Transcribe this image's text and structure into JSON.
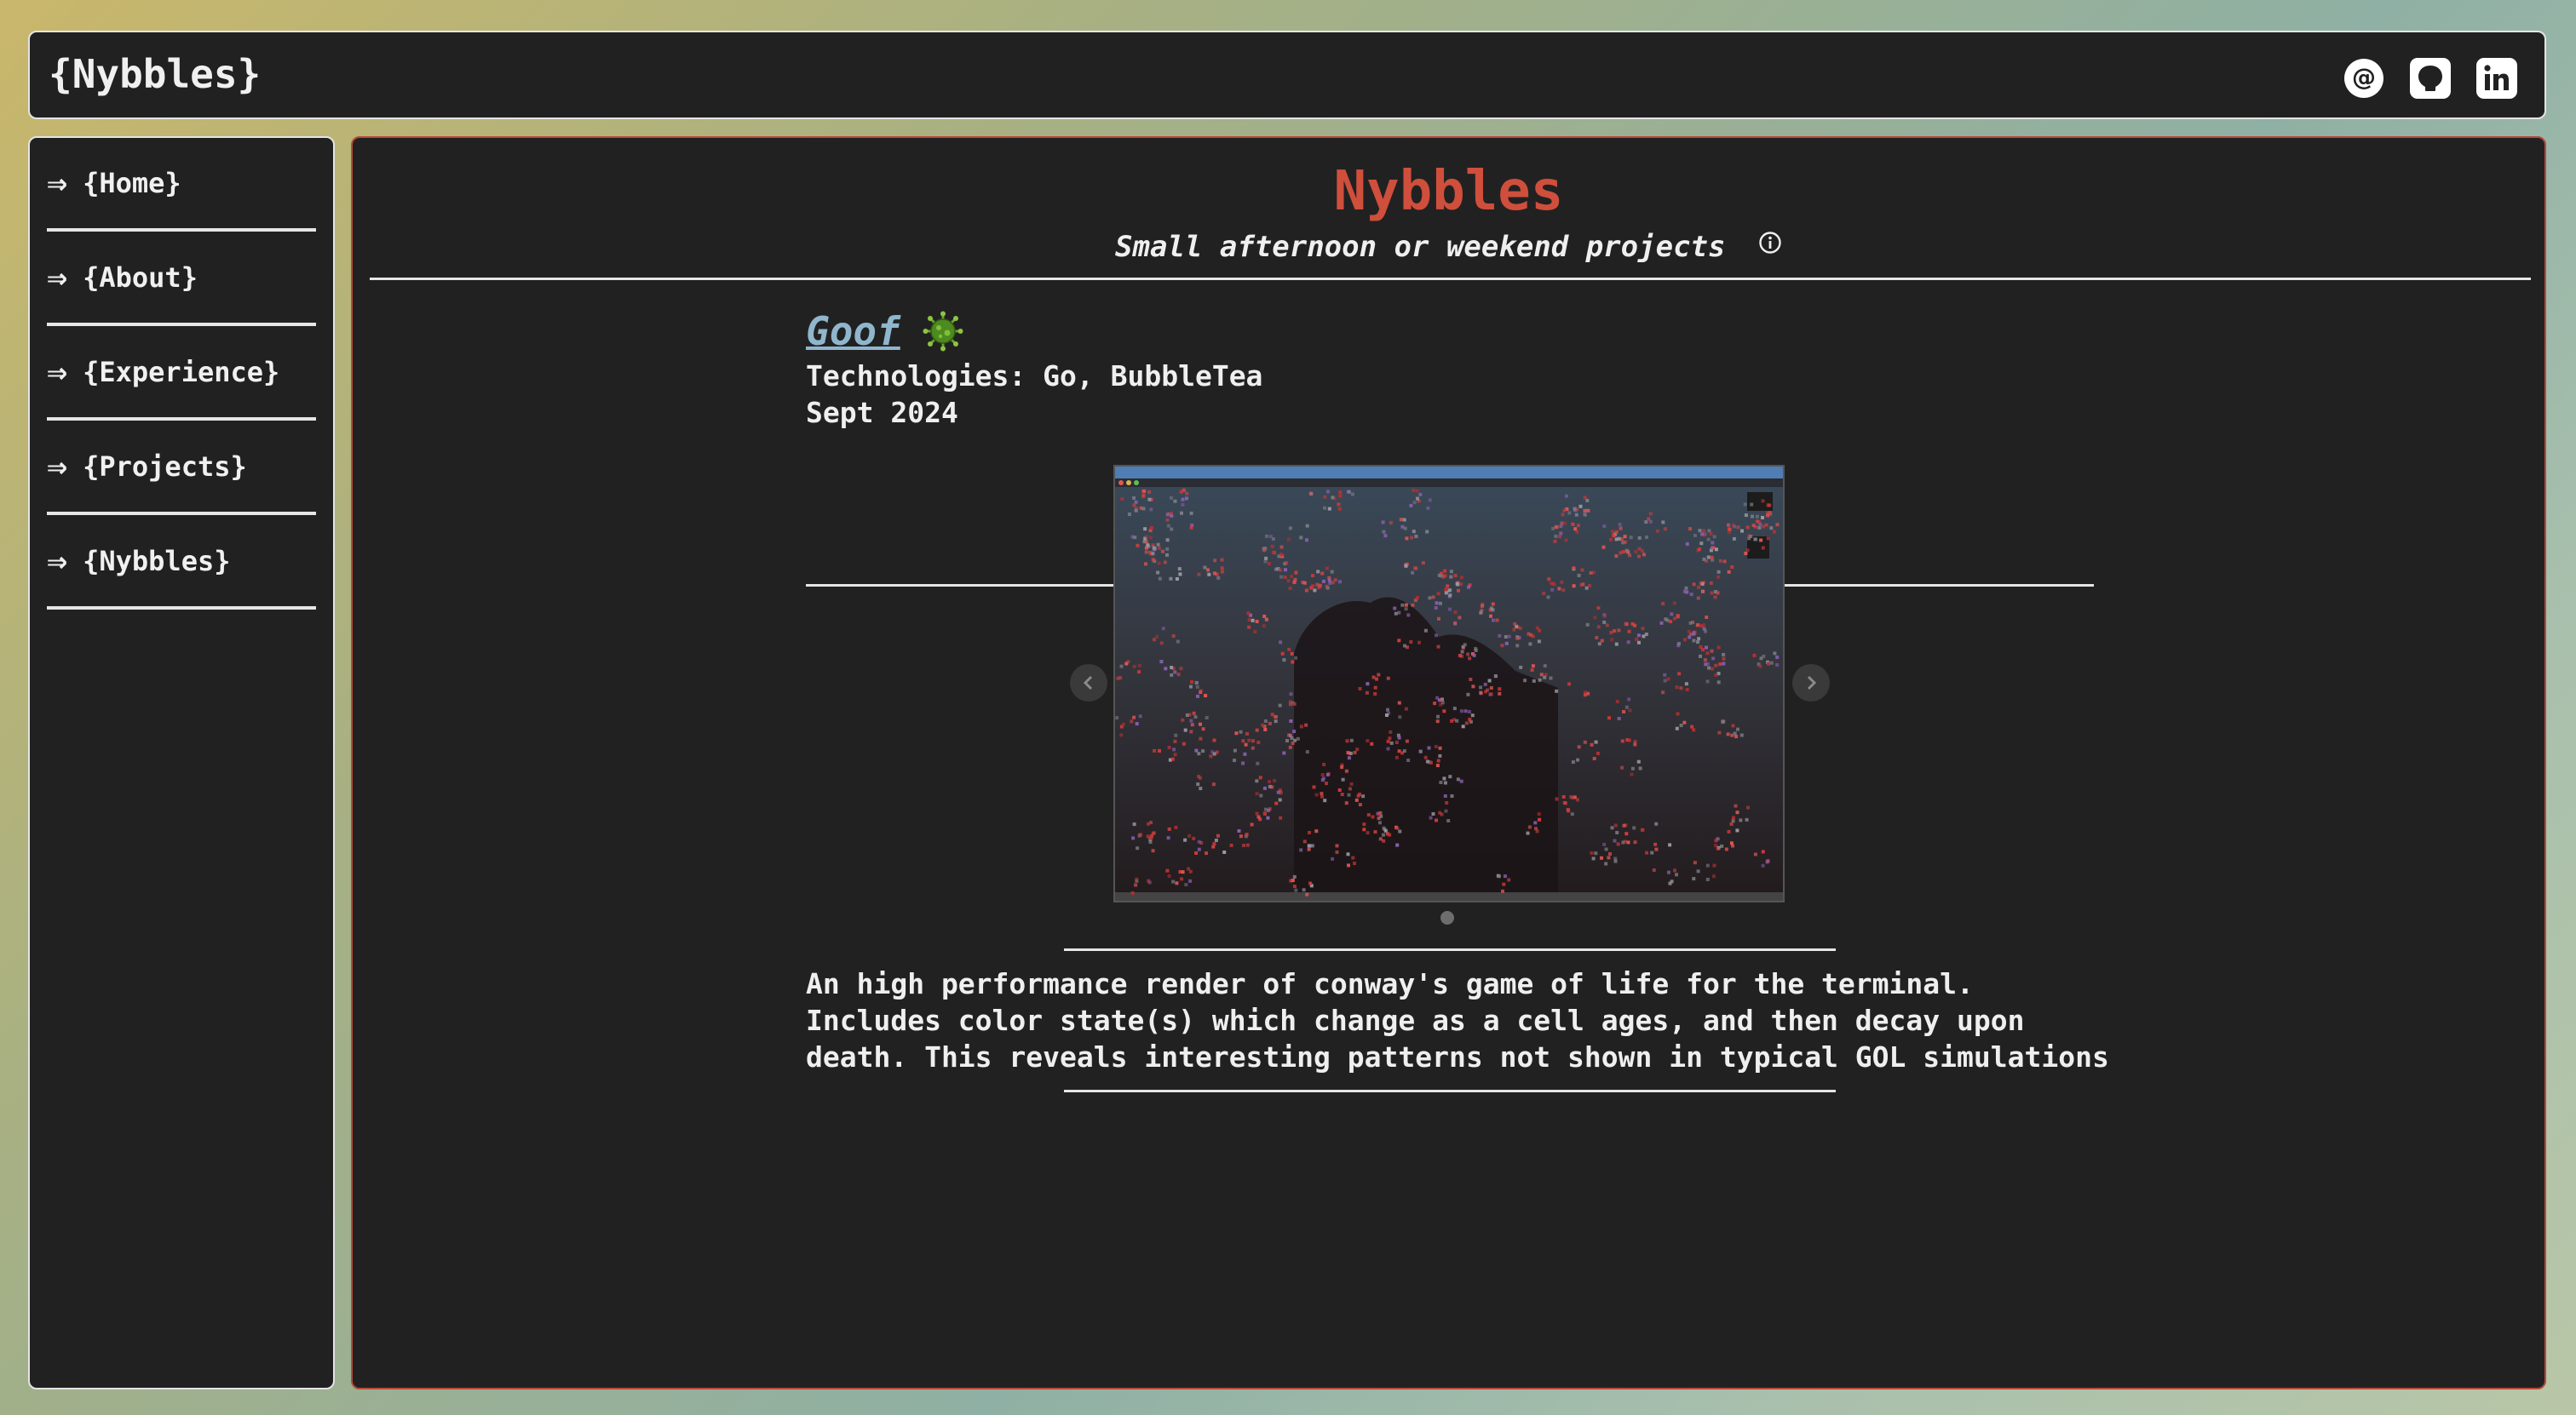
{
  "header": {
    "brand": "{Nybbles}",
    "social": [
      {
        "icon": "at-icon"
      },
      {
        "icon": "github-icon"
      },
      {
        "icon": "linkedin-icon"
      }
    ]
  },
  "sidebar": {
    "arrow": "⇒",
    "items": [
      {
        "label": "{Home}"
      },
      {
        "label": "{About}"
      },
      {
        "label": "{Experience}"
      },
      {
        "label": "{Projects}"
      },
      {
        "label": "{Nybbles}"
      }
    ]
  },
  "main": {
    "title": "Nybbles",
    "subtitle": "Small afternoon or weekend projects",
    "project": {
      "name": "Goof",
      "technologies": "Technologies: Go, BubbleTea",
      "date": "Sept 2024",
      "description": "An high performance render of conway's game of life for the terminal. Includes color state(s) which change as a cell ages, and then decay upon death. This reveals interesting patterns not shown in typical GOL simulations"
    }
  },
  "colors": {
    "accent": "#cf4f3c",
    "link": "#8fb6cc",
    "panel": "#222122"
  }
}
